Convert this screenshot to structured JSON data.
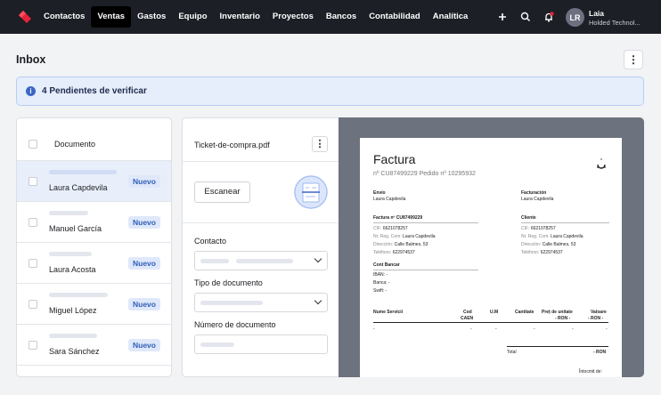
{
  "nav": {
    "items": [
      "Contactos",
      "Ventas",
      "Gastos",
      "Equipo",
      "Inventario",
      "Proyectos",
      "Bancos",
      "Contabilidad",
      "Analítica"
    ],
    "active": "Ventas"
  },
  "user": {
    "initials": "LR",
    "name": "Laia",
    "org": "Holded Technol..."
  },
  "page": {
    "title": "Inbox",
    "banner": "4 Pendientes de verificar",
    "more": "⋮"
  },
  "list": {
    "header": "Documento",
    "rows": [
      {
        "name": "Laura Capdevila",
        "badge": "Nuevo"
      },
      {
        "name": "Manuel García",
        "badge": "Nuevo"
      },
      {
        "name": "Laura Acosta",
        "badge": "Nuevo"
      },
      {
        "name": "Miguel López",
        "badge": "Nuevo"
      },
      {
        "name": "Sara Sánchez",
        "badge": "Nuevo"
      }
    ]
  },
  "detail": {
    "file_name": "Ticket-de-compra.pdf",
    "scan_label": "Escanear",
    "contact_label": "Contacto",
    "doc_type_label": "Tipo de documento",
    "doc_number_label": "Número de documento"
  },
  "invoice": {
    "title": "Factura",
    "subtitle": "nº CU87499229 Pedido nº 10295932",
    "envio_label": "Envío",
    "envio_name": "Laura Capdevila",
    "facturacion_label": "Facturación",
    "facturacion_name": "Laura Capdevila",
    "factura_no": "Factura nº CU87499229",
    "cliente_label": "Cliente",
    "cif_label": "CIF:",
    "cif_value": "6621078257",
    "reg_label": "Nr. Reg. Com:",
    "reg_value": "Laura Capdevila",
    "dir_label": "Dirección:",
    "dir_value": "Calle Balmes, 53",
    "tel_label": "Teléfono:",
    "tel_value": "622974537",
    "bank_label": "Cont Bancar",
    "iban": "IBAN: -",
    "banca": "Banca: -",
    "swift": "Swift: -",
    "col_service": "Nume Servicii",
    "col_cod": "Cod",
    "col_caen": "CAEN",
    "col_um": "U.M",
    "col_qty": "Cantitate",
    "col_price": "Preț de unitate",
    "col_price_cur": "- RON -",
    "col_val": "Valoare",
    "col_val_cur": "- RON -",
    "dash": "-",
    "total_label": "Total",
    "total_value": "- RON",
    "footer": "Întocmit de:"
  }
}
